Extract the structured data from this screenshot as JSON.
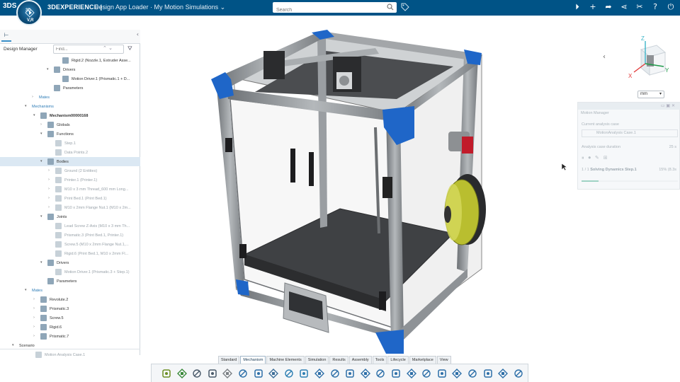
{
  "topbar": {
    "brand_ds": "3DS",
    "compass_top": "3D",
    "compass_bottom": "V,R",
    "brand": "3DEXPERIENCE |",
    "title": "Design App Loader · My Motion Simulations ⌄",
    "search_placeholder": "Search"
  },
  "panel": {
    "title": "Design Manager",
    "find_placeholder": "Find...",
    "tree": [
      {
        "label": "Rigid.2 (Nozzle.1, Extruder Asse...",
        "indent": 88,
        "tw": "",
        "state": ""
      },
      {
        "label": "Drivers",
        "indent": 76,
        "tw": "▾",
        "state": ""
      },
      {
        "label": "Motion Driver.1 (Prismatic.1 + D...",
        "indent": 88,
        "tw": "",
        "state": ""
      },
      {
        "label": "Parameters",
        "indent": 76,
        "tw": "",
        "state": ""
      },
      {
        "label": "Mates",
        "indent": 55,
        "tw": "›",
        "state": "blue noicon"
      },
      {
        "label": "Mechanisms",
        "indent": 45,
        "tw": "▾",
        "state": "blue noicon"
      },
      {
        "label": "Mechanism00000168",
        "indent": 57,
        "tw": "▾",
        "state": "bold"
      },
      {
        "label": "Globals",
        "indent": 67,
        "tw": "›",
        "state": ""
      },
      {
        "label": "Functions",
        "indent": 67,
        "tw": "▾",
        "state": ""
      },
      {
        "label": "Step.1",
        "indent": 78,
        "tw": "",
        "state": "dim"
      },
      {
        "label": "Data Points.2",
        "indent": 78,
        "tw": "",
        "state": "dim"
      },
      {
        "label": "Bodies",
        "indent": 67,
        "tw": "▾",
        "state": "sel"
      },
      {
        "label": "Ground (2 Entities)",
        "indent": 78,
        "tw": "›",
        "state": "dim"
      },
      {
        "label": "Printer.1 (Printer.1)",
        "indent": 78,
        "tw": "›",
        "state": "dim"
      },
      {
        "label": "M10 x 3 mm Thread_600 mm Long...",
        "indent": 78,
        "tw": "›",
        "state": "dim"
      },
      {
        "label": "Print Bed.1 (Print Bed.1)",
        "indent": 78,
        "tw": "›",
        "state": "dim"
      },
      {
        "label": "M10 x 2mm Flange Nut.1 (M10 x 2m...",
        "indent": 78,
        "tw": "›",
        "state": "dim"
      },
      {
        "label": "Joints",
        "indent": 67,
        "tw": "▾",
        "state": ""
      },
      {
        "label": "Lead Screw Z-Axis (M10 x 3 mm Th...",
        "indent": 78,
        "tw": "",
        "state": "dim"
      },
      {
        "label": "Prismatic.3 (Print Bed.1, Printer.1)",
        "indent": 78,
        "tw": "",
        "state": "dim"
      },
      {
        "label": "Screw.5 (M10 x 2mm Flange Nut.1,...",
        "indent": 78,
        "tw": "",
        "state": "dim"
      },
      {
        "label": "Rigid.6 (Print Bed.1, M10 x 2mm Fl...",
        "indent": 78,
        "tw": "",
        "state": "dim"
      },
      {
        "label": "Drivers",
        "indent": 67,
        "tw": "▾",
        "state": ""
      },
      {
        "label": "Motion Driver.1 (Prismatic.3 + Step.1)",
        "indent": 78,
        "tw": "",
        "state": "dim"
      },
      {
        "label": "Parameters",
        "indent": 67,
        "tw": "",
        "state": ""
      },
      {
        "label": "Mates",
        "indent": 45,
        "tw": "▾",
        "state": "blue noicon"
      },
      {
        "label": "Revolute.2",
        "indent": 57,
        "tw": "›",
        "state": ""
      },
      {
        "label": "Prismatic.3",
        "indent": 57,
        "tw": "›",
        "state": ""
      },
      {
        "label": "Screw.5",
        "indent": 57,
        "tw": "›",
        "state": ""
      },
      {
        "label": "Rigid.6",
        "indent": 57,
        "tw": "›",
        "state": ""
      },
      {
        "label": "Prismatic.7",
        "indent": 57,
        "tw": "›",
        "state": ""
      },
      {
        "label": "Scenario",
        "indent": 27,
        "tw": "▾",
        "state": "noicon"
      },
      {
        "label": "Motion Analysis Case.1",
        "indent": 50,
        "tw": "",
        "state": "dim"
      }
    ]
  },
  "viewport": {
    "units": "mm",
    "axis_x": "X",
    "axis_y": "Y",
    "axis_z": "Z"
  },
  "motion_manager": {
    "title": "Motion Manager",
    "case_label": "Current analysis case",
    "case_value": "MotionAnalysis Case.1",
    "duration_label": "Analysis case duration",
    "duration_value": "25 s",
    "step_count": "1 / 1",
    "step_name": "Solving Dynamics Step.1",
    "step_percent": "15% (8.3s",
    "progress": 0.18
  },
  "bottom_tabs": [
    "Standard",
    "Mechanism",
    "Machine Elements",
    "Simulation",
    "Results",
    "Assembly",
    "Tools",
    "Lifecycle",
    "Marketplace",
    "View"
  ],
  "active_tab": "Mechanism",
  "toolbar_icons": [
    "mechanism-icon",
    "globals-icon",
    "save-icon",
    "multisave-icon",
    "settings-icon",
    "undo-icon",
    "redo-icon",
    "help-icon",
    "body-icon",
    "assembly-icon",
    "joint-icon",
    "revolute-icon",
    "prismatic-icon",
    "screw-icon",
    "gear-icon",
    "spring-icon",
    "contact-icon",
    "driver-icon",
    "sensor-icon",
    "result-icon",
    "plot-icon",
    "animation-icon",
    "export-icon",
    "report-icon"
  ],
  "colors": {
    "topbar": "#005386",
    "accent": "#3a8fc8",
    "frame": "#8c8f92",
    "corner_blue": "#1f66c8",
    "filament": "#bfc43a"
  }
}
